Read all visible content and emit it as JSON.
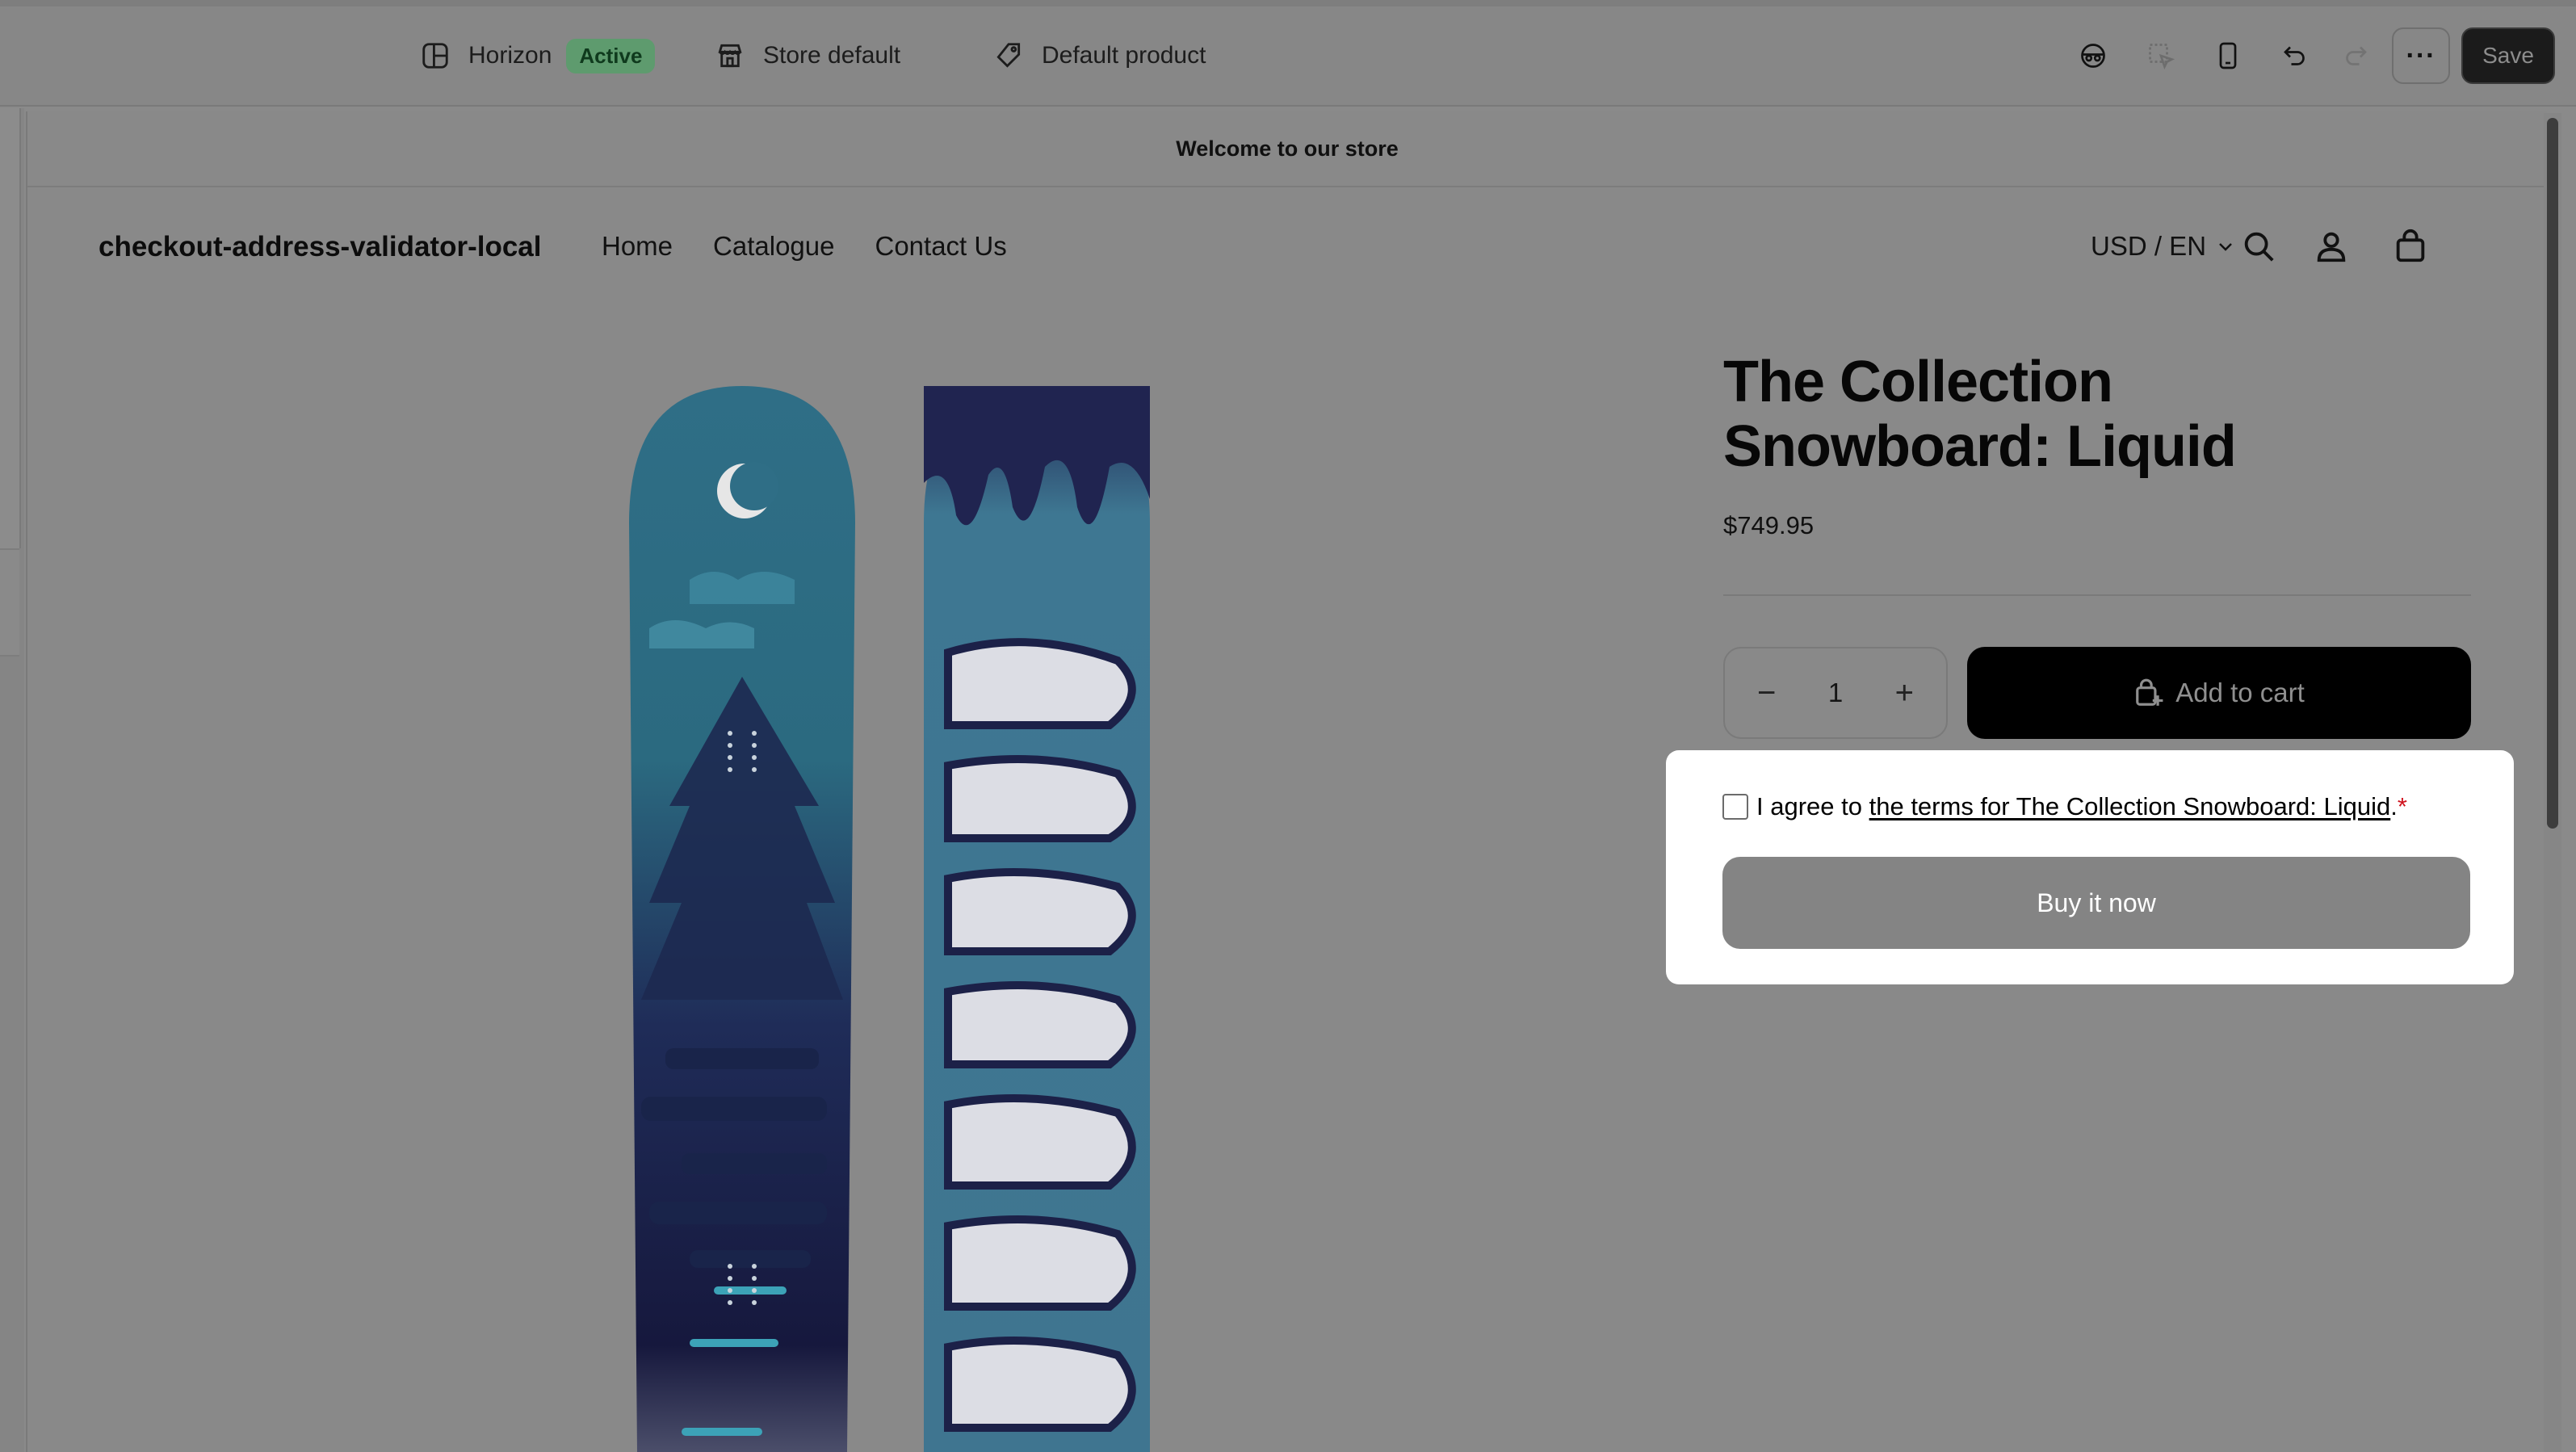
{
  "editor": {
    "theme_name": "Horizon",
    "theme_status": "Active",
    "market": "Store default",
    "template": "Default product",
    "more_label": "···",
    "save_label": "Save"
  },
  "store": {
    "announcement": "Welcome to our store",
    "brand": "checkout-address-validator-local",
    "nav": [
      "Home",
      "Catalogue",
      "Contact Us"
    ],
    "locale": "USD / EN"
  },
  "product": {
    "title_line1": "The Collection",
    "title_line2": "Snowboard: Liquid",
    "price": "$749.95",
    "quantity": "1",
    "add_to_cart": "Add to cart",
    "agree_prefix": "I agree to ",
    "terms_link": "the terms for The Collection Snowboard: Liquid",
    "agree_suffix": ".",
    "required_mark": "*",
    "buy_now": "Buy it now"
  },
  "colors": {
    "overlay": "#8a8a8a",
    "badge_bg": "#5e9b6e",
    "required": "#d0131e"
  }
}
